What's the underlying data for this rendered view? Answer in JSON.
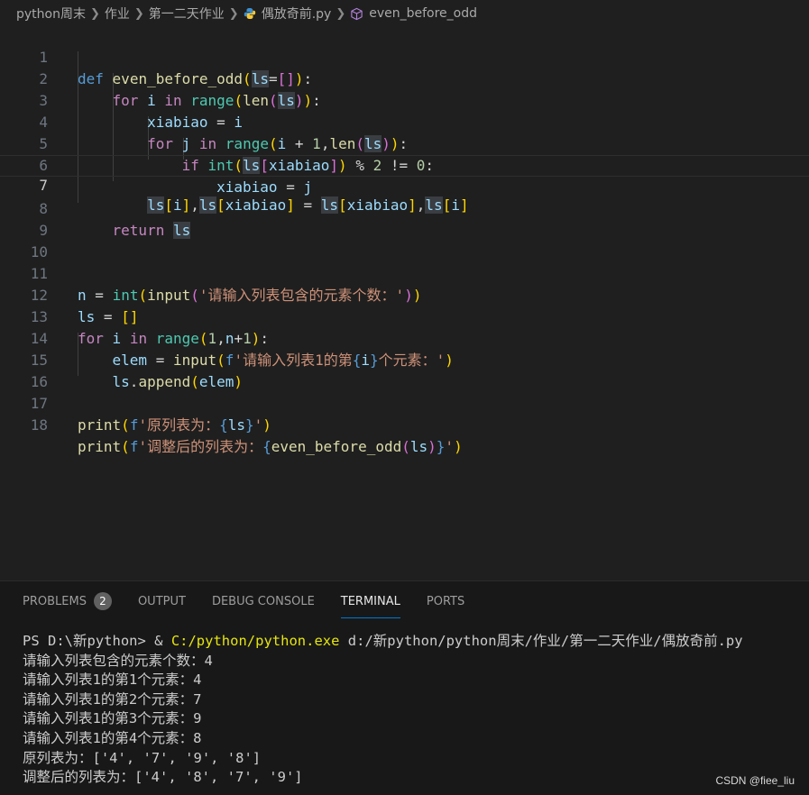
{
  "breadcrumb": {
    "items": [
      "python周末",
      "作业",
      "第一二天作业",
      "偶放奇前.py",
      "even_before_odd"
    ]
  },
  "editor": {
    "line_numbers": [
      "1",
      "2",
      "3",
      "4",
      "5",
      "6",
      "7",
      "8",
      "9",
      "10",
      "11",
      "12",
      "13",
      "14",
      "15",
      "16",
      "17",
      "18"
    ],
    "active_line": "7"
  },
  "panel": {
    "tabs": [
      {
        "label": "PROBLEMS",
        "badge": "2"
      },
      {
        "label": "OUTPUT"
      },
      {
        "label": "DEBUG CONSOLE"
      },
      {
        "label": "TERMINAL",
        "active": true
      },
      {
        "label": "PORTS"
      }
    ]
  },
  "terminal": {
    "prompt": "PS D:\\新python> & ",
    "exe": "C:/python/python.exe",
    "script_path": " d:/新python/python周末/作业/第一二天作业/偶放奇前.py",
    "lines": [
      "请输入列表包含的元素个数：4",
      "请输入列表1的第1个元素：4",
      "请输入列表1的第2个元素：7",
      "请输入列表1的第3个元素：9",
      "请输入列表1的第4个元素：8",
      "原列表为：['4', '7', '9', '8']",
      "调整后的列表为：['4', '8', '7', '9']"
    ]
  },
  "watermark": "CSDN @fiee_liu",
  "colors": {
    "background": "#1f1f1f",
    "panel": "#181818",
    "accent": "#0078d4"
  },
  "icons": [
    "python-file-icon",
    "symbol-method-icon"
  ]
}
